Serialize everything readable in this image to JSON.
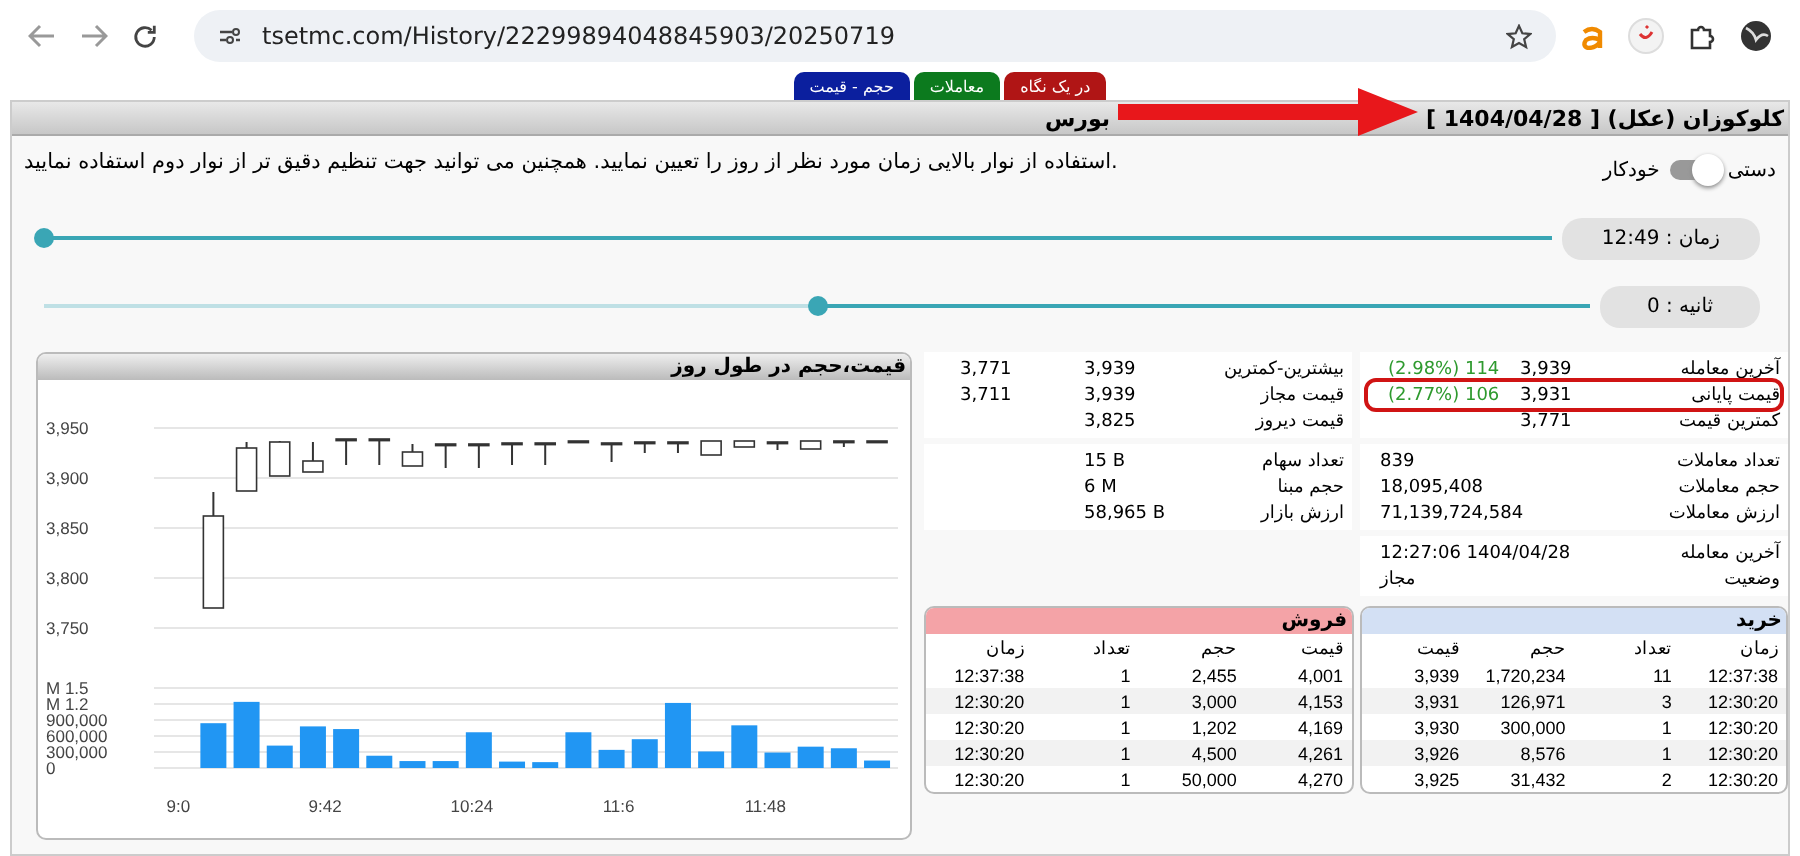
{
  "browser": {
    "url": "tsetmc.com/History/22299894048845903/20250719"
  },
  "tabs": [
    {
      "label": "در یک نگاه",
      "color": "#b01515"
    },
    {
      "label": "معاملات",
      "color": "#0c7a1e"
    },
    {
      "label": "حجم - قیمت",
      "color": "#0b1f9e"
    }
  ],
  "title": {
    "main": "کلوکوزان (عکل) [ 1404/04/28 ]",
    "rest": "بورس"
  },
  "intro": ".استفاده از نوار بالایی زمان مورد نظر از روز را تعیین نمایید. همچنین می توانید جهت تنظیم دقیق تر از نوار دوم استفاده نمایید",
  "mode_toggle": {
    "left_label": "خودکار",
    "right_label": "دستی",
    "on": false
  },
  "sliders": [
    {
      "label": "زمان : 12:49",
      "level": 1
    },
    {
      "label": "ثانیه : 0",
      "level": 0.5
    }
  ],
  "chart": {
    "title": "قیمت،حجم در طول روز",
    "price_chart": {
      "chart_data": {
        "type": "candlestick",
        "grid": true,
        "ylim": [
          3750,
          3950
        ],
        "yticks": [
          {
            "value": 3750,
            "label": "3,750"
          },
          {
            "value": 3800,
            "label": "3,800"
          },
          {
            "value": 3850,
            "label": "3,850"
          },
          {
            "value": 3900,
            "label": "3,900"
          },
          {
            "value": 3950,
            "label": "3,950"
          }
        ],
        "x": [
          550,
          559.5,
          569,
          578.5,
          588,
          597.5,
          607,
          616.5,
          626,
          635.5,
          645,
          654.5,
          664,
          673.5,
          683,
          692.5,
          702,
          711.5,
          721,
          730.5,
          740
        ],
        "xlim": [
          533,
          746
        ],
        "ohlc": [
          [
            3770,
            3886,
            3770,
            3862
          ],
          [
            3887,
            3936,
            3887,
            3930
          ],
          [
            3902,
            3937,
            3902,
            3936
          ],
          [
            3906,
            3936,
            3906,
            3917
          ],
          [
            3939,
            3939,
            3913,
            3939
          ],
          [
            3939,
            3939,
            3913,
            3939
          ],
          [
            3912,
            3934,
            3912,
            3926
          ],
          [
            3934,
            3934,
            3910,
            3934
          ],
          [
            3934,
            3934,
            3910,
            3934
          ],
          [
            3935,
            3935,
            3913,
            3935
          ],
          [
            3935,
            3935,
            3913,
            3935
          ],
          [
            3937,
            3937,
            3937,
            3937
          ],
          [
            3935,
            3935,
            3916,
            3935
          ],
          [
            3936,
            3936,
            3925,
            3936
          ],
          [
            3936,
            3936,
            3925,
            3936
          ],
          [
            3923,
            3937,
            3923,
            3937
          ],
          [
            3931,
            3937,
            3931,
            3937
          ],
          [
            3936,
            3936,
            3928,
            3936
          ],
          [
            3929,
            3937,
            3929,
            3937
          ],
          [
            3937,
            3937,
            3931,
            3937
          ],
          [
            3937,
            3937,
            3937,
            3937
          ]
        ]
      }
    },
    "volume_chart": {
      "chart_data": {
        "type": "bar",
        "grid": true,
        "x": [
          550,
          559.5,
          569,
          578.5,
          588,
          597.5,
          607,
          616.5,
          626,
          635.5,
          645,
          654.5,
          664,
          673.5,
          683,
          692.5,
          702,
          711.5,
          721,
          730.5,
          740
        ],
        "xlim": [
          533,
          746
        ],
        "xticks": [
          {
            "value": 540,
            "label": "9:0"
          },
          {
            "value": 582,
            "label": "9:42"
          },
          {
            "value": 624,
            "label": "10:24"
          },
          {
            "value": 666,
            "label": "11:6"
          },
          {
            "value": 708,
            "label": "11:48"
          }
        ],
        "ylim": [
          0,
          1500000
        ],
        "yticks": [
          {
            "value": 0,
            "label": "0"
          },
          {
            "value": 300000,
            "label": "300,000"
          },
          {
            "value": 600000,
            "label": "600,000"
          },
          {
            "value": 900000,
            "label": "900,000"
          },
          {
            "value": 1200000,
            "label": "M 1.2"
          },
          {
            "value": 1500000,
            "label": "M 1.5"
          }
        ],
        "series": [
          {
            "color": "#2196f3",
            "values": [
              840000,
              1240000,
              420000,
              780000,
              730000,
              230000,
              130000,
              130000,
              670000,
              120000,
              110000,
              670000,
              340000,
              540000,
              1220000,
              310000,
              800000,
              290000,
              400000,
              370000,
              140000
            ]
          }
        ]
      }
    }
  },
  "price_info": {
    "right": [
      {
        "label": "آخرین معامله",
        "value": "3,939",
        "change": "(2.98%) 114",
        "highlighted": false
      },
      {
        "label": "قیمت پایانی",
        "value": "3,931",
        "change": "(2.77%) 106",
        "highlighted": true
      },
      {
        "label": "کمترین قیمت",
        "value": "3,771",
        "highlighted": false
      }
    ],
    "left": [
      {
        "label": "بیشترین-کمترین",
        "value": "3,939",
        "value2": "3,771"
      },
      {
        "label": "قیمت مجاز",
        "value": "3,939",
        "value2": "3,711"
      },
      {
        "label": "قیمت دیروز",
        "value": "3,825"
      }
    ]
  },
  "trade_info": {
    "right": [
      {
        "label": "تعداد معاملات",
        "value": "839"
      },
      {
        "label": "حجم معاملات",
        "value": "18,095,408"
      },
      {
        "label": "ارزش معاملات",
        "value": "71,139,724,584"
      }
    ],
    "left": [
      {
        "label": "تعداد سهام",
        "value": "15 B"
      },
      {
        "label": "حجم مبنا",
        "value": "6 M"
      },
      {
        "label": "ارزش بازار",
        "value": "58,965 B"
      }
    ]
  },
  "status_info": [
    {
      "label": "آخرین معامله",
      "value": "12:27:06 1404/04/28"
    },
    {
      "label": "وضعیت",
      "value": "مجاز"
    }
  ],
  "buy": {
    "title": "خرید",
    "columns": [
      "زمان",
      "تعداد",
      "حجم",
      "قیمت"
    ],
    "rows": [
      [
        "12:37:38",
        "11",
        "1,720,234",
        "3,939"
      ],
      [
        "12:30:20",
        "3",
        "126,971",
        "3,931"
      ],
      [
        "12:30:20",
        "1",
        "300,000",
        "3,930"
      ],
      [
        "12:30:20",
        "1",
        "8,576",
        "3,926"
      ],
      [
        "12:30:20",
        "2",
        "31,432",
        "3,925"
      ]
    ]
  },
  "sell": {
    "title": "فروش",
    "columns": [
      "قیمت",
      "حجم",
      "تعداد",
      "زمان"
    ],
    "rows": [
      [
        "4,001",
        "2,455",
        "1",
        "12:37:38"
      ],
      [
        "4,153",
        "3,000",
        "1",
        "12:30:20"
      ],
      [
        "4,169",
        "1,202",
        "1",
        "12:30:20"
      ],
      [
        "4,261",
        "4,500",
        "1",
        "12:30:20"
      ],
      [
        "4,270",
        "50,000",
        "1",
        "12:30:20"
      ]
    ]
  }
}
